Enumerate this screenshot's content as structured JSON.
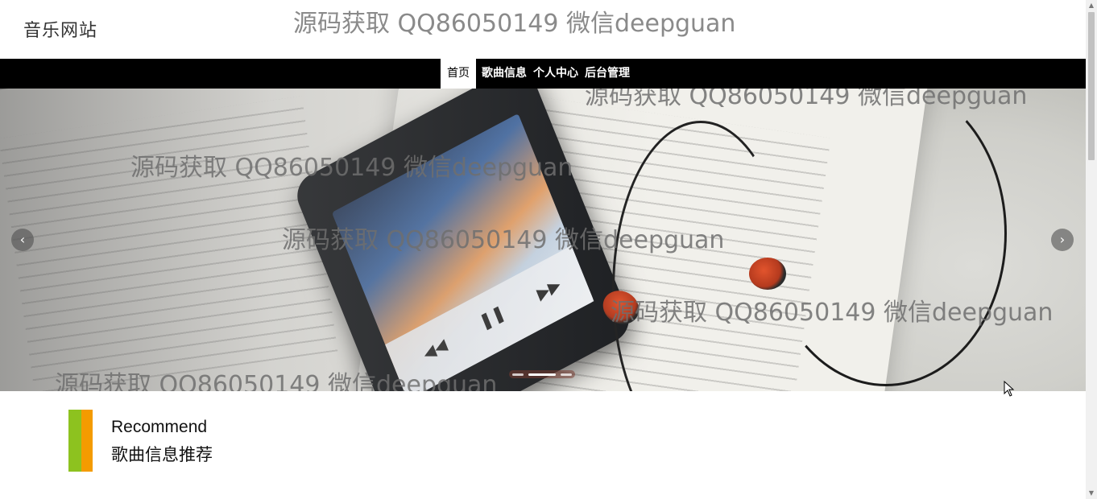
{
  "header": {
    "site_title": "音乐网站",
    "watermark": "源码获取 QQ86050149 微信deepguan"
  },
  "nav": {
    "items": [
      {
        "label": "首页",
        "active": true
      },
      {
        "label": "歌曲信息",
        "active": false
      },
      {
        "label": "个人中心",
        "active": false
      },
      {
        "label": "后台管理",
        "active": false
      }
    ]
  },
  "banner": {
    "watermarks": [
      "源码获取 QQ86050149 微信deepguan",
      "源码获取 QQ86050149 微信deepguan",
      "源码获取 QQ86050149 微信deepguan",
      "源码获取 QQ86050149 微信deepguan",
      "源码获取 QQ86050149 微信deepguan"
    ],
    "prev_glyph": "‹",
    "next_glyph": "›",
    "slide_count": 3,
    "active_slide": 2
  },
  "recommend": {
    "title_en": "Recommend",
    "title_cn": "歌曲信息推荐",
    "colors": {
      "green": "#8dc21f",
      "orange": "#f49b00"
    }
  },
  "icons": {
    "prev": "chevron-left-icon",
    "next": "chevron-right-icon",
    "scroll_up": "triangle-up-icon",
    "scroll_down": "triangle-down-icon",
    "cursor": "mouse-pointer-icon"
  }
}
